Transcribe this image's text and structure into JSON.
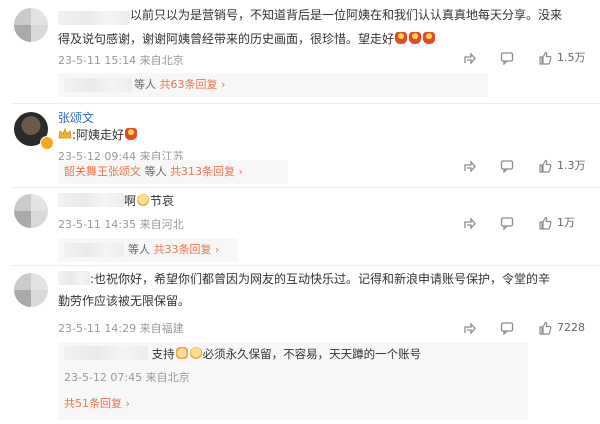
{
  "comments": [
    {
      "text_line1": "以前只以为是营销号，不知道背后是一位阿姨在和我们认认真真地每天分享。没来",
      "text_line2": "得及说句感谢，谢谢阿姨曾经带来的历史画面，很珍惜。望走好",
      "meta": "23-5-11 15:14 来自北京",
      "reply_prefix": "等人",
      "reply_link": "共63条回复",
      "likes": "1.5万"
    },
    {
      "author": "张颂文",
      "text": ":阿姨走好",
      "meta": "23-5-12 09:44 来自江苏",
      "reply_user": "韶关舞王张颂文",
      "reply_prefix": "等人",
      "reply_link": "共313条回复",
      "likes": "1.3万"
    },
    {
      "text": "啊",
      "text_tail": "节哀",
      "meta": "23-5-11 14:35 来自河北",
      "reply_prefix": "等人",
      "reply_link": "共33条回复",
      "likes": "1万"
    },
    {
      "text_line1": ":也祝你好，希望你们都曾因为网友的互动快乐过。记得和新浪申请账号保护，令堂的辛",
      "text_line2": "勤劳作应该被无限保留。",
      "meta": "23-5-11 14:29 来自福建",
      "likes": "7228",
      "sub_reply": {
        "text_a": "支持",
        "text_b": "必须永久保留，不容易，天天蹲的一个账号",
        "meta": "23-5-12 07:45 来自北京"
      },
      "reply_link": "共51条回复"
    }
  ],
  "colors": {
    "accent": "#eb7350",
    "name_blue": "#2d6ac9",
    "meta": "#999999"
  },
  "icons": [
    "share-icon",
    "comment-icon",
    "like-icon"
  ]
}
